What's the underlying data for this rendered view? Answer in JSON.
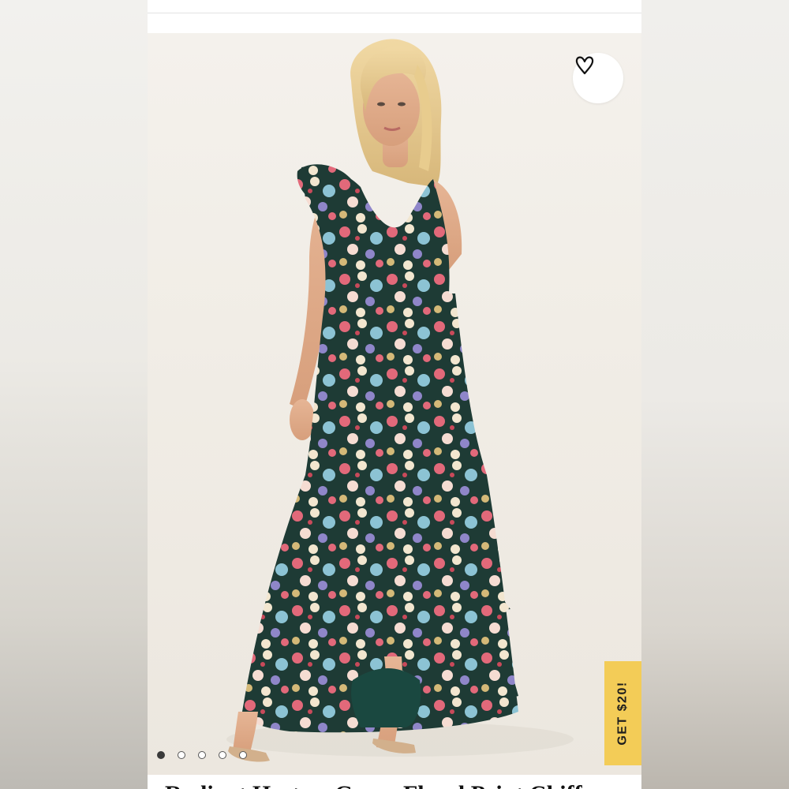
{
  "product": {
    "title": "Radiant Hostess Green Floral Print Chiff",
    "image_alt": "Model wearing a floral print chiffon maxi dress"
  },
  "wishlist": {
    "icon": "heart-outline-icon",
    "label": ""
  },
  "carousel": {
    "total": 5,
    "active_index": 0
  },
  "promo": {
    "label": "GET $20!",
    "color": "#f3cc57"
  },
  "colors": {
    "dress_base": "#1e3b35",
    "accent_pink": "#e2697a",
    "accent_blue": "#8cc3d4",
    "accent_lavender": "#8f86c9"
  }
}
